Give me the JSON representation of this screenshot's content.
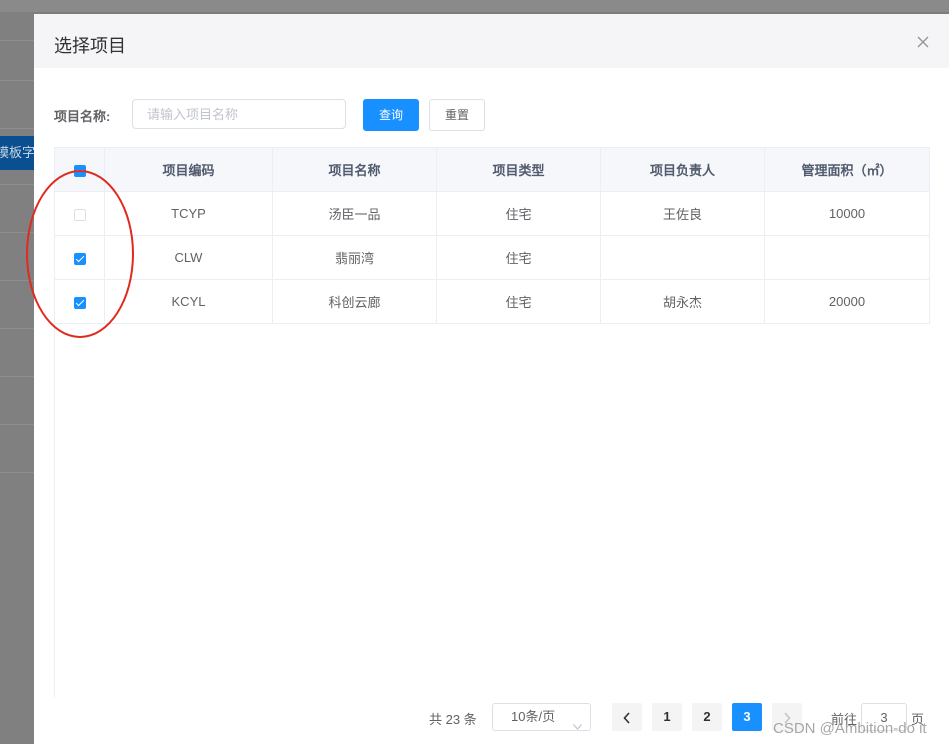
{
  "background": {
    "tag_text": "模板字段"
  },
  "dialog": {
    "title": "选择项目",
    "close_icon": "close-icon"
  },
  "search": {
    "label": "项目名称:",
    "placeholder": "请输入项目名称",
    "value": "",
    "query_label": "查询",
    "reset_label": "重置"
  },
  "table": {
    "headers": [
      "项目编码",
      "项目名称",
      "项目类型",
      "项目负责人",
      "管理面积（㎡）"
    ],
    "select_all_state": "indeterminate",
    "rows": [
      {
        "checked": false,
        "code": "TCYP",
        "name": "汤臣一品",
        "type": "住宅",
        "manager": "王佐良",
        "area": "10000"
      },
      {
        "checked": true,
        "code": "CLW",
        "name": "翡丽湾",
        "type": "住宅",
        "manager": "",
        "area": ""
      },
      {
        "checked": true,
        "code": "KCYL",
        "name": "科创云廊",
        "type": "住宅",
        "manager": "胡永杰",
        "area": "20000"
      }
    ]
  },
  "pagination": {
    "total_text": "共 23 条",
    "page_size": "10条/页",
    "pages": [
      "1",
      "2",
      "3"
    ],
    "current_page": "3",
    "goto_prefix": "前往",
    "goto_value": "3",
    "goto_suffix": "页"
  },
  "watermark": "CSDN @Ambition-do it",
  "colors": {
    "primary": "#1890ff",
    "annotation": "#e02a20"
  }
}
